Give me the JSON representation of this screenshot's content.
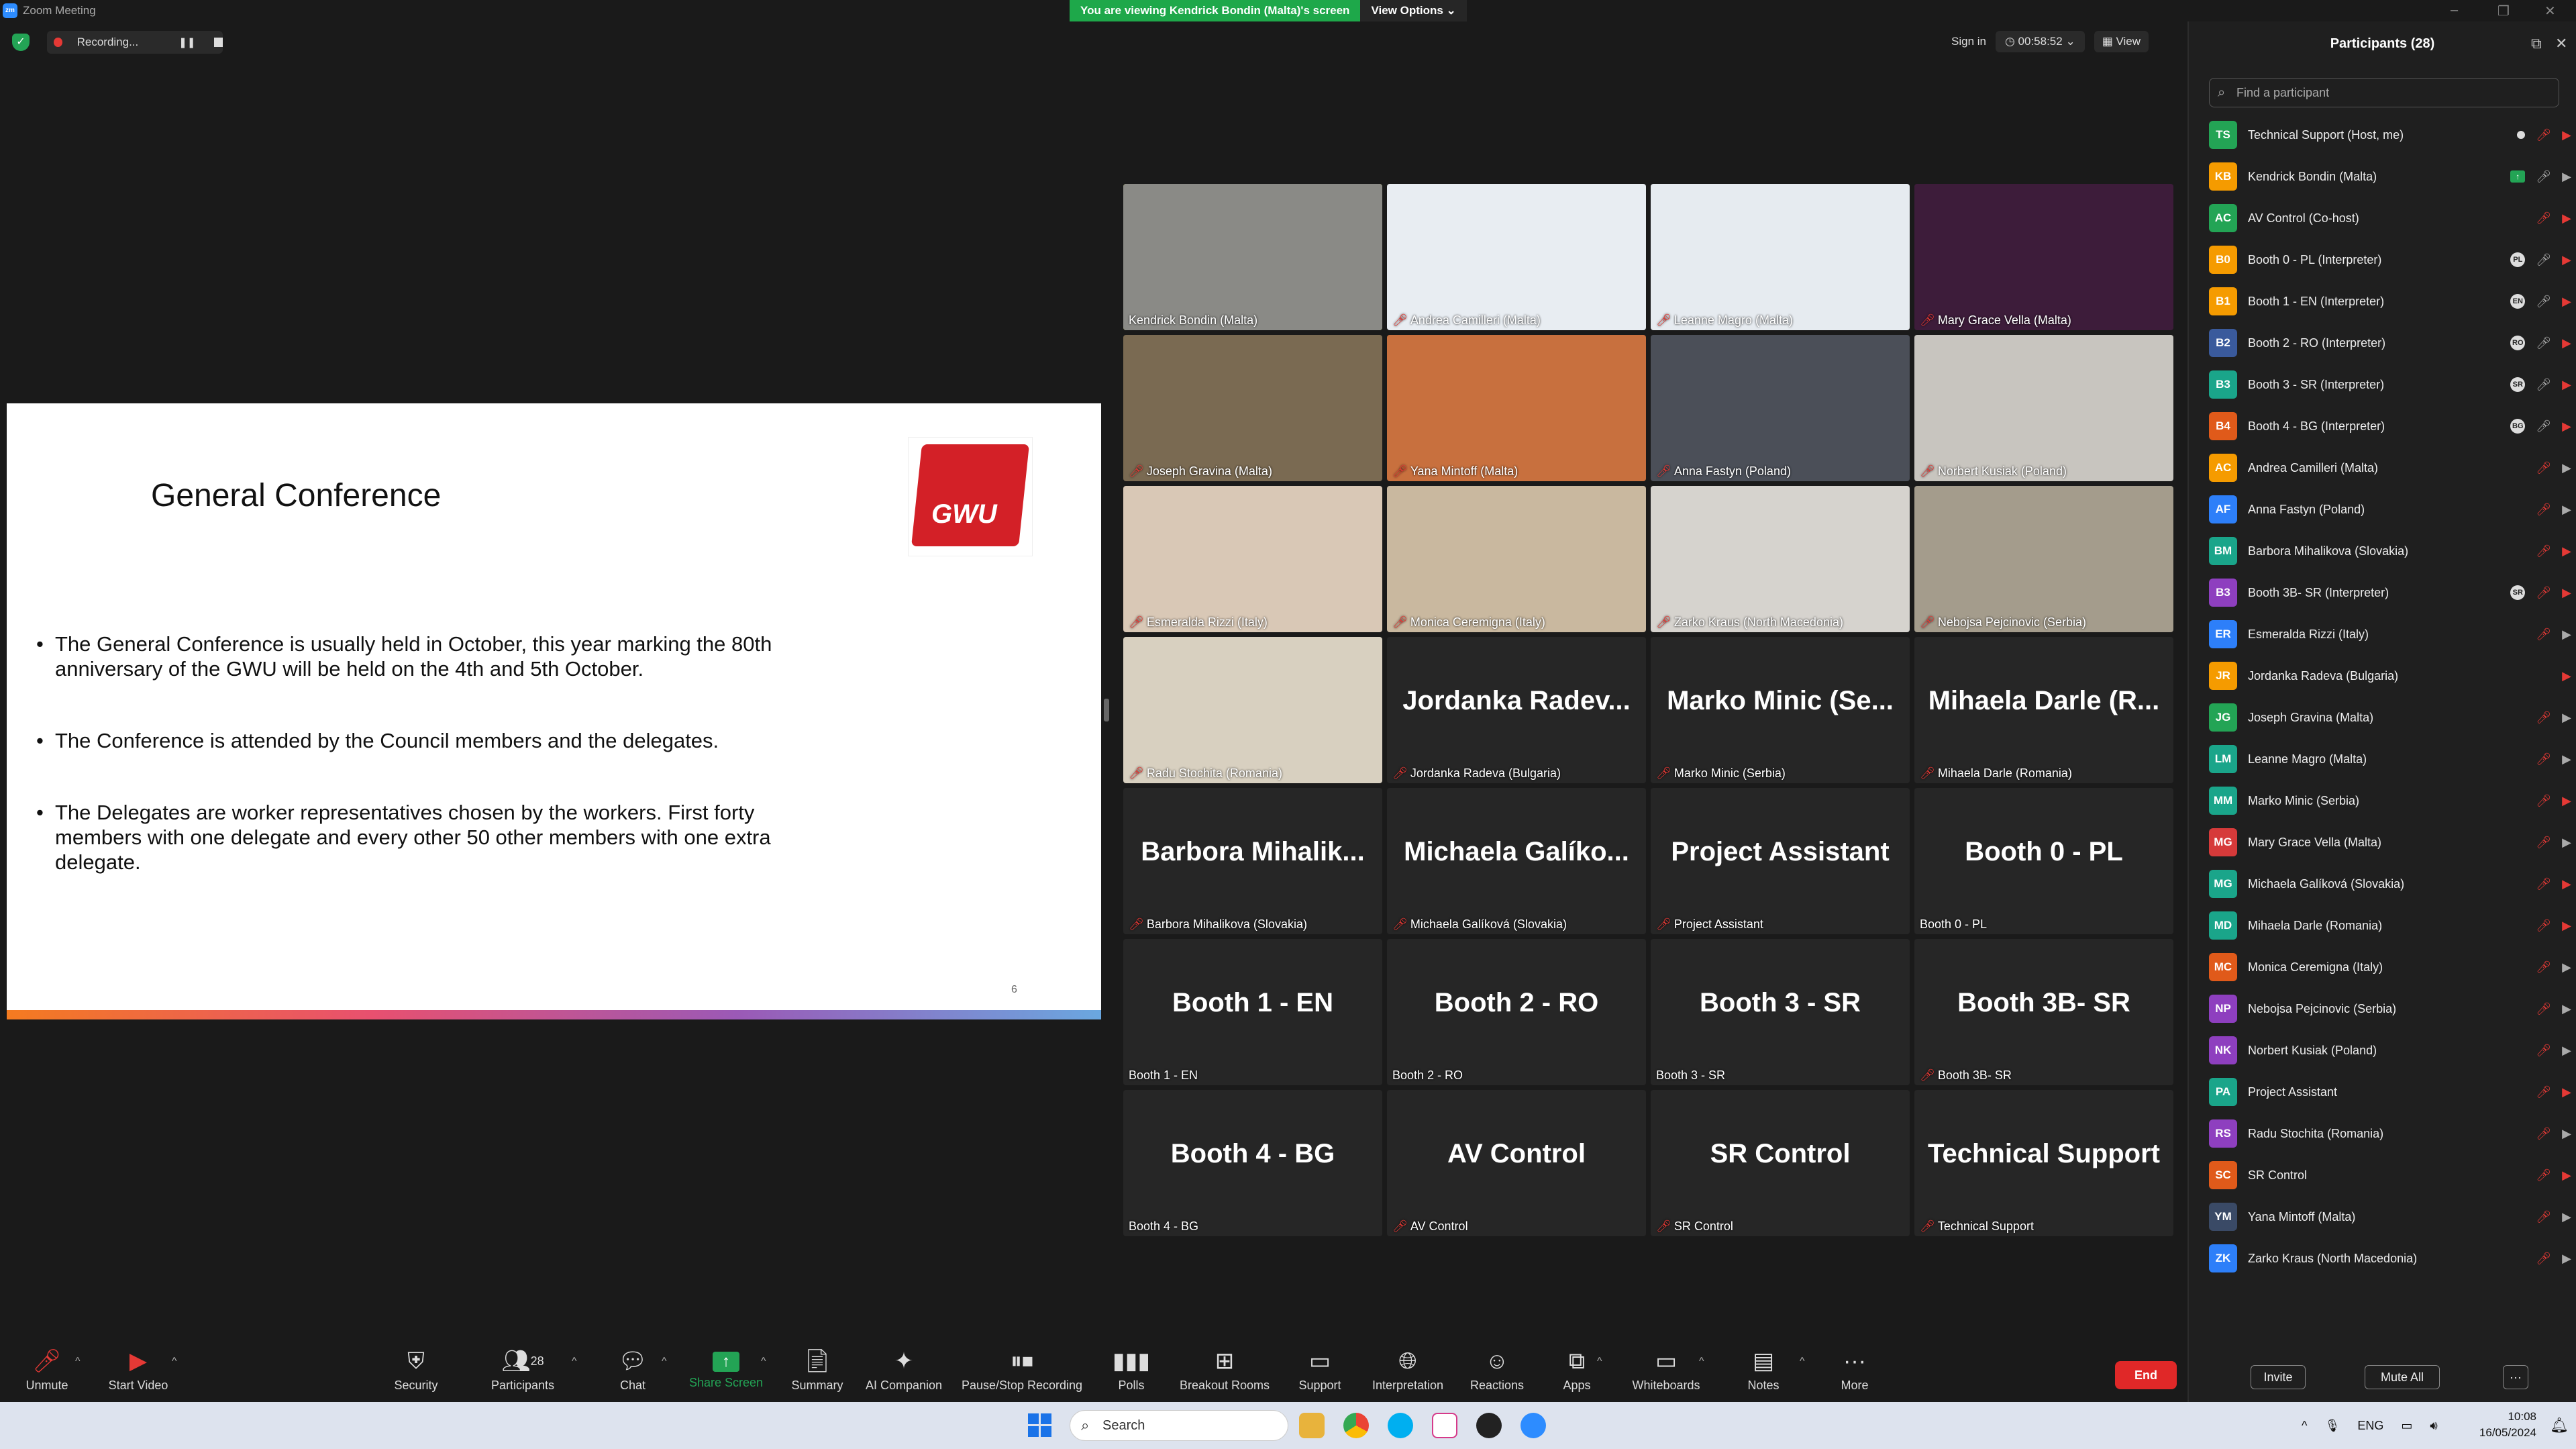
{
  "window": {
    "title": "Zoom Meeting",
    "app_badge": "zm"
  },
  "banner": {
    "viewing": "You are viewing Kendrick Bondin (Malta)'s screen",
    "view_options": "View Options"
  },
  "recording": {
    "label": "Recording..."
  },
  "top_right": {
    "sign_in": "Sign in",
    "timer": "00:58:52",
    "view": "View"
  },
  "slide": {
    "title": "General Conference",
    "logo_text": "GWU",
    "bullets": [
      "The General Conference is usually held in October, this year marking the 80th anniversary of the GWU will be held on the 4th and 5th October.",
      "The Conference is attended by the Council members and the delegates.",
      "The Delegates are worker representatives chosen by the workers. First forty members with one delegate and every other 50 other members with one extra delegate."
    ],
    "page_number": "6"
  },
  "tiles": [
    {
      "label": "Kendrick Bondin (Malta)",
      "big": "",
      "muted": false,
      "video": true,
      "active": true,
      "bg": "#8a8a86"
    },
    {
      "label": "Andrea Camilleri (Malta)",
      "big": "",
      "muted": true,
      "video": true,
      "bg": "#e8edf2"
    },
    {
      "label": "Leanne Magro (Malta)",
      "big": "",
      "muted": true,
      "video": true,
      "bg": "#e6ebf0"
    },
    {
      "label": "Mary Grace Vella (Malta)",
      "big": "",
      "muted": true,
      "video": true,
      "bg": "#3d1c3a"
    },
    {
      "label": "Joseph Gravina (Malta)",
      "big": "",
      "muted": true,
      "video": true,
      "bg": "#7a6a52"
    },
    {
      "label": "Yana Mintoff (Malta)",
      "big": "",
      "muted": true,
      "video": true,
      "bg": "#c8703e"
    },
    {
      "label": "Anna Fastyn (Poland)",
      "big": "",
      "muted": true,
      "video": true,
      "bg": "#4b4f58"
    },
    {
      "label": "Norbert Kusiak (Poland)",
      "big": "",
      "muted": true,
      "video": true,
      "bg": "#c8c5bf"
    },
    {
      "label": "Esmeralda Rizzi (Italy)",
      "big": "",
      "muted": true,
      "video": true,
      "bg": "#d9c8b6"
    },
    {
      "label": "Monica Ceremigna (Italy)",
      "big": "",
      "muted": true,
      "video": true,
      "bg": "#c9b89f"
    },
    {
      "label": "Zarko Kraus (North Macedonia)",
      "big": "",
      "muted": true,
      "video": true,
      "bg": "#d6d3ce"
    },
    {
      "label": "Nebojsa Pejcinovic (Serbia)",
      "big": "",
      "muted": true,
      "video": true,
      "bg": "#a49c8c"
    },
    {
      "label": "Radu Stochita (Romania)",
      "big": "",
      "muted": true,
      "video": true,
      "bg": "#d8d0c0"
    },
    {
      "label": "Jordanka Radeva (Bulgaria)",
      "big": "Jordanka Radev...",
      "muted": true,
      "video": false
    },
    {
      "label": "Marko Minic (Serbia)",
      "big": "Marko Minic (Se...",
      "muted": true,
      "video": false
    },
    {
      "label": "Mihaela Darle (Romania)",
      "big": "Mihaela Darle (R...",
      "muted": true,
      "video": false
    },
    {
      "label": "Barbora Mihalikova (Slovakia)",
      "big": "Barbora Mihalik...",
      "muted": true,
      "video": false
    },
    {
      "label": "Michaela Galíková (Slovakia)",
      "big": "Michaela Galíko...",
      "muted": true,
      "video": false
    },
    {
      "label": "Project Assistant",
      "big": "Project Assistant",
      "muted": true,
      "video": false
    },
    {
      "label": "Booth 0 - PL",
      "big": "Booth 0 - PL",
      "muted": false,
      "video": false
    },
    {
      "label": "Booth 1 - EN",
      "big": "Booth 1 - EN",
      "muted": false,
      "video": false
    },
    {
      "label": "Booth 2 - RO",
      "big": "Booth 2 - RO",
      "muted": false,
      "video": false
    },
    {
      "label": "Booth 3 - SR",
      "big": "Booth 3 - SR",
      "muted": false,
      "video": false
    },
    {
      "label": "Booth 3B- SR",
      "big": "Booth 3B- SR",
      "muted": true,
      "video": false
    },
    {
      "label": "Booth 4 - BG",
      "big": "Booth 4 - BG",
      "muted": false,
      "video": false
    },
    {
      "label": "AV Control",
      "big": "AV Control",
      "muted": true,
      "video": false
    },
    {
      "label": "SR Control",
      "big": "SR Control",
      "muted": true,
      "video": false
    },
    {
      "label": "Technical Support",
      "big": "Technical Support",
      "muted": true,
      "video": false
    }
  ],
  "participants_panel": {
    "title": "Participants (28)",
    "search_placeholder": "Find a participant",
    "invite": "Invite",
    "mute_all": "Mute All",
    "list": [
      {
        "initials": "TS",
        "name": "Technical Support (Host, me)",
        "color": "#23a455",
        "lang": "dot",
        "mic": "m",
        "cam": "c"
      },
      {
        "initials": "KB",
        "name": "Kendrick Bondin (Malta)",
        "color": "#f59b00",
        "lang": "share",
        "mic": "mo",
        "cam": "co"
      },
      {
        "initials": "AC",
        "name": "AV Control (Co-host)",
        "color": "#23a455",
        "lang": "",
        "mic": "m",
        "cam": "c"
      },
      {
        "initials": "B0",
        "name": "Booth 0 - PL (Interpreter)",
        "color": "#f59b00",
        "lang": "PL",
        "mic": "mo",
        "cam": "c"
      },
      {
        "initials": "B1",
        "name": "Booth 1 - EN (Interpreter)",
        "color": "#f59b00",
        "lang": "EN",
        "mic": "mo",
        "cam": "c"
      },
      {
        "initials": "B2",
        "name": "Booth 2 - RO (Interpreter)",
        "color": "#3a5a9c",
        "lang": "RO",
        "mic": "mo",
        "cam": "c"
      },
      {
        "initials": "B3",
        "name": "Booth 3 - SR (Interpreter)",
        "color": "#1aa58a",
        "lang": "SR",
        "mic": "mo",
        "cam": "c"
      },
      {
        "initials": "B4",
        "name": "Booth 4 - BG (Interpreter)",
        "color": "#e05a1a",
        "lang": "BG",
        "mic": "mo",
        "cam": "c"
      },
      {
        "initials": "AC",
        "name": "Andrea Camilleri (Malta)",
        "color": "#f59b00",
        "lang": "",
        "mic": "m",
        "cam": "co"
      },
      {
        "initials": "AF",
        "name": "Anna Fastyn (Poland)",
        "color": "#2d7ff9",
        "lang": "",
        "mic": "m",
        "cam": "co"
      },
      {
        "initials": "BM",
        "name": "Barbora Mihalikova (Slovakia)",
        "color": "#1aa58a",
        "lang": "",
        "mic": "m",
        "cam": "c"
      },
      {
        "initials": "B3",
        "name": "Booth 3B- SR (Interpreter)",
        "color": "#8e3fbf",
        "lang": "SR",
        "mic": "m",
        "cam": "c"
      },
      {
        "initials": "ER",
        "name": "Esmeralda Rizzi (Italy)",
        "color": "#2d7ff9",
        "lang": "",
        "mic": "m",
        "cam": "co"
      },
      {
        "initials": "JR",
        "name": "Jordanka Radeva (Bulgaria)",
        "color": "#f59b00",
        "lang": "",
        "mic": "",
        "cam": "c"
      },
      {
        "initials": "JG",
        "name": "Joseph Gravina (Malta)",
        "color": "#23a455",
        "lang": "",
        "mic": "m",
        "cam": "co"
      },
      {
        "initials": "LM",
        "name": "Leanne Magro (Malta)",
        "color": "#1aa58a",
        "lang": "",
        "mic": "m",
        "cam": "co"
      },
      {
        "initials": "MM",
        "name": "Marko Minic (Serbia)",
        "color": "#1aa58a",
        "lang": "",
        "mic": "m",
        "cam": "c"
      },
      {
        "initials": "MG",
        "name": "Mary Grace Vella (Malta)",
        "color": "#d63a3a",
        "lang": "",
        "mic": "m",
        "cam": "co"
      },
      {
        "initials": "MG",
        "name": "Michaela Galíková (Slovakia)",
        "color": "#1aa58a",
        "lang": "",
        "mic": "m",
        "cam": "c"
      },
      {
        "initials": "MD",
        "name": "Mihaela Darle (Romania)",
        "color": "#1aa58a",
        "lang": "",
        "mic": "m",
        "cam": "c"
      },
      {
        "initials": "MC",
        "name": "Monica Ceremigna (Italy)",
        "color": "#e05a1a",
        "lang": "",
        "mic": "m",
        "cam": "co"
      },
      {
        "initials": "NP",
        "name": "Nebojsa Pejcinovic (Serbia)",
        "color": "#8e3fbf",
        "lang": "",
        "mic": "m",
        "cam": "co"
      },
      {
        "initials": "NK",
        "name": "Norbert Kusiak (Poland)",
        "color": "#8e3fbf",
        "lang": "",
        "mic": "m",
        "cam": "co"
      },
      {
        "initials": "PA",
        "name": "Project Assistant",
        "color": "#1aa58a",
        "lang": "",
        "mic": "m",
        "cam": "c"
      },
      {
        "initials": "RS",
        "name": "Radu Stochita (Romania)",
        "color": "#8e3fbf",
        "lang": "",
        "mic": "m",
        "cam": "co"
      },
      {
        "initials": "SC",
        "name": "SR Control",
        "color": "#e05a1a",
        "lang": "",
        "mic": "m",
        "cam": "c"
      },
      {
        "initials": "YM",
        "name": "Yana Mintoff (Malta)",
        "color": "#3a4a66",
        "lang": "",
        "mic": "m",
        "cam": "co"
      },
      {
        "initials": "ZK",
        "name": "Zarko Kraus (North Macedonia)",
        "color": "#2d7ff9",
        "lang": "",
        "mic": "m",
        "cam": "co"
      }
    ]
  },
  "toolbar": {
    "unmute": "Unmute",
    "start_video": "Start Video",
    "security": "Security",
    "participants": "Participants",
    "participants_count": "28",
    "chat": "Chat",
    "share_screen": "Share Screen",
    "summary": "Summary",
    "ai_companion": "AI Companion",
    "pause_stop_recording": "Pause/Stop Recording",
    "polls": "Polls",
    "breakout_rooms": "Breakout Rooms",
    "support": "Support",
    "interpretation": "Interpretation",
    "reactions": "Reactions",
    "apps": "Apps",
    "whiteboards": "Whiteboards",
    "notes": "Notes",
    "more": "More",
    "end": "End"
  },
  "taskbar": {
    "search_placeholder": "Search",
    "lang": "ENG",
    "time": "10:08",
    "date": "16/05/2024"
  }
}
